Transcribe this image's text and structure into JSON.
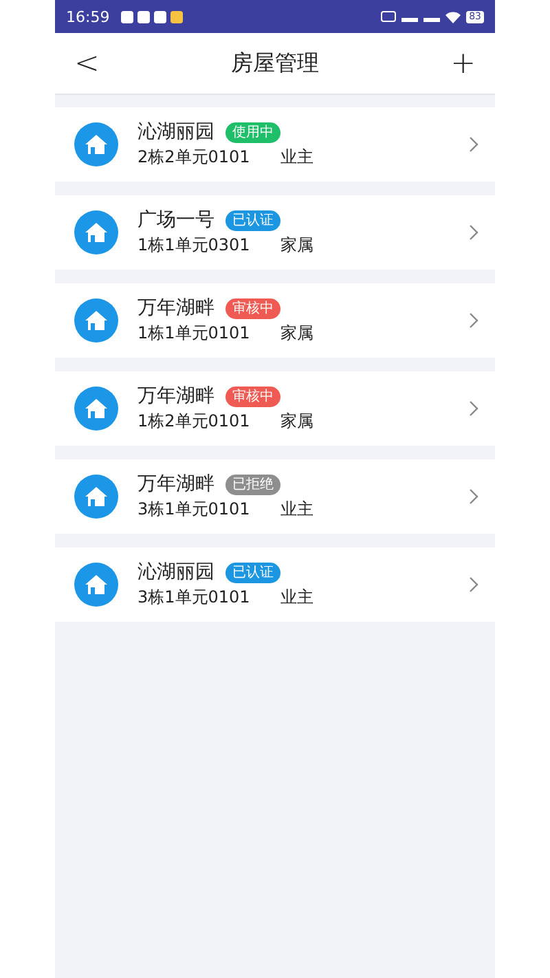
{
  "status_bar": {
    "time": "16:59",
    "battery": "83"
  },
  "header": {
    "back": "<",
    "title": "房屋管理",
    "add": "+"
  },
  "houses": [
    {
      "name": "沁湖丽园",
      "status": "使用中",
      "color": "#1fbf6a",
      "unit": "2栋2单元0101",
      "role": "业主"
    },
    {
      "name": "广场一号",
      "status": "已认证",
      "color": "#1c96e0",
      "unit": "1栋1单元0301",
      "role": "家属"
    },
    {
      "name": "万年湖畔",
      "status": "审核中",
      "color": "#ef5a52",
      "unit": "1栋1单元0101",
      "role": "家属"
    },
    {
      "name": "万年湖畔",
      "status": "审核中",
      "color": "#ef5a52",
      "unit": "1栋2单元0101",
      "role": "家属"
    },
    {
      "name": "万年湖畔",
      "status": "已拒绝",
      "color": "#8e8e8e",
      "unit": "3栋1单元0101",
      "role": "业主"
    },
    {
      "name": "沁湖丽园",
      "status": "已认证",
      "color": "#1c96e0",
      "unit": "3栋1单元0101",
      "role": "业主"
    }
  ]
}
